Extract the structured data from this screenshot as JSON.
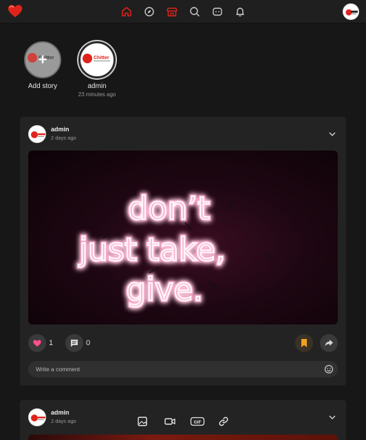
{
  "nav": {
    "icons": [
      "home-icon",
      "explore-icon",
      "store-icon",
      "search-icon",
      "chat-icon",
      "bell-icon"
    ],
    "accent": "#e0241b"
  },
  "brand": {
    "logo_text": "Chitter",
    "logo_tagline": "Think it, chatterit",
    "color": "#e0241b"
  },
  "stories": [
    {
      "label": "Add story",
      "time": ""
    },
    {
      "label": "admin",
      "time": "23 minutes ago"
    }
  ],
  "posts": [
    {
      "author": "admin",
      "time": "2 days ago",
      "image_alt": "don't just take, give.",
      "likes": "1",
      "comments": "0",
      "like_color": "#ff4d8d",
      "bookmark_color": "#f0a020",
      "comment_placeholder": "Write a comment"
    },
    {
      "author": "admin",
      "time": "2 days ago"
    }
  ],
  "composer_icons": [
    "image-icon",
    "video-icon",
    "gif-icon",
    "link-icon"
  ]
}
